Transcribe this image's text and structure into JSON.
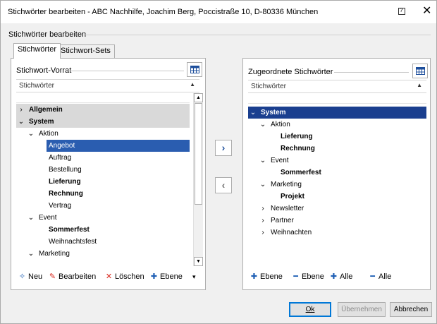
{
  "window": {
    "title": "Stichwörter bearbeiten - ABC Nachhilfe, Joachim Berg, Poccistraße 10, D-80336 München",
    "help_icon": "help-icon",
    "close_glyph": "✕"
  },
  "group_label": "Stichwörter bearbeiten",
  "tabs": [
    {
      "label": "Stichwörter",
      "active": true
    },
    {
      "label": "Stichwort-Sets",
      "active": false
    }
  ],
  "left_panel": {
    "title": "Stichwort-Vorrat",
    "column_header": "Stichwörter",
    "tree": [
      {
        "label": "Allgemein",
        "level": 0,
        "arrow": "›",
        "bold": true,
        "grey": true
      },
      {
        "label": "System",
        "level": 0,
        "arrow": "⌄",
        "bold": true,
        "grey": true
      },
      {
        "label": "Aktion",
        "level": 1,
        "arrow": "⌄",
        "bold": false
      },
      {
        "label": "Angebot",
        "level": 2,
        "arrow": "",
        "bold": false,
        "selected": true
      },
      {
        "label": "Auftrag",
        "level": 2,
        "arrow": "",
        "bold": false
      },
      {
        "label": "Bestellung",
        "level": 2,
        "arrow": "",
        "bold": false
      },
      {
        "label": "Lieferung",
        "level": 2,
        "arrow": "",
        "bold": true
      },
      {
        "label": "Rechnung",
        "level": 2,
        "arrow": "",
        "bold": true
      },
      {
        "label": "Vertrag",
        "level": 2,
        "arrow": "",
        "bold": false
      },
      {
        "label": "Event",
        "level": 1,
        "arrow": "⌄",
        "bold": false
      },
      {
        "label": "Sommerfest",
        "level": 2,
        "arrow": "",
        "bold": true
      },
      {
        "label": "Weihnachtsfest",
        "level": 2,
        "arrow": "",
        "bold": false
      },
      {
        "label": "Marketing",
        "level": 1,
        "arrow": "⌄",
        "bold": false
      }
    ],
    "toolbar": [
      {
        "icon": "✧",
        "label": "Neu",
        "name": "new-button"
      },
      {
        "icon": "✎",
        "label": "Bearbeiten",
        "name": "edit-button"
      },
      {
        "icon": "✕",
        "label": "Löschen",
        "name": "delete-button"
      },
      {
        "icon": "✚",
        "label": "Ebene",
        "name": "add-level-button"
      }
    ],
    "toolbar_more": "▾"
  },
  "move_buttons": {
    "right": "›",
    "left": "‹"
  },
  "right_panel": {
    "title": "Zugeordnete Stichwörter",
    "column_header": "Stichwörter",
    "tree": [
      {
        "label": "System",
        "level": 0,
        "arrow": "⌄",
        "bold": true,
        "selected_full": true
      },
      {
        "label": "Aktion",
        "level": 1,
        "arrow": "⌄",
        "bold": false
      },
      {
        "label": "Lieferung",
        "level": 2,
        "arrow": "",
        "bold": true
      },
      {
        "label": "Rechnung",
        "level": 2,
        "arrow": "",
        "bold": true
      },
      {
        "label": "Event",
        "level": 1,
        "arrow": "⌄",
        "bold": false
      },
      {
        "label": "Sommerfest",
        "level": 2,
        "arrow": "",
        "bold": true
      },
      {
        "label": "Marketing",
        "level": 1,
        "arrow": "⌄",
        "bold": false
      },
      {
        "label": "Projekt",
        "level": 2,
        "arrow": "",
        "bold": true
      },
      {
        "label": "Newsletter",
        "level": 1,
        "arrow": "›",
        "bold": false
      },
      {
        "label": "Partner",
        "level": 1,
        "arrow": "›",
        "bold": false
      },
      {
        "label": "Weihnachten",
        "level": 1,
        "arrow": "›",
        "bold": false
      }
    ],
    "toolbar": [
      {
        "icon": "✚",
        "label": "Ebene",
        "name": "add-level-button"
      },
      {
        "icon": "━",
        "label": "Ebene",
        "name": "remove-level-button"
      },
      {
        "icon": "✚",
        "label": "Alle",
        "name": "add-all-button"
      },
      {
        "icon": "━",
        "label": "Alle",
        "name": "remove-all-button"
      }
    ]
  },
  "buttons": {
    "ok": "Ok",
    "apply": "Übernehmen",
    "cancel": "Abbrechen"
  },
  "colors": {
    "accent": "#1e4f9c",
    "selection": "#2a5db0",
    "selection_dark": "#1a3f8f",
    "green_icon": "#1e8c3a",
    "red_icon": "#d9281e",
    "blue_icon": "#1e5fb4"
  }
}
